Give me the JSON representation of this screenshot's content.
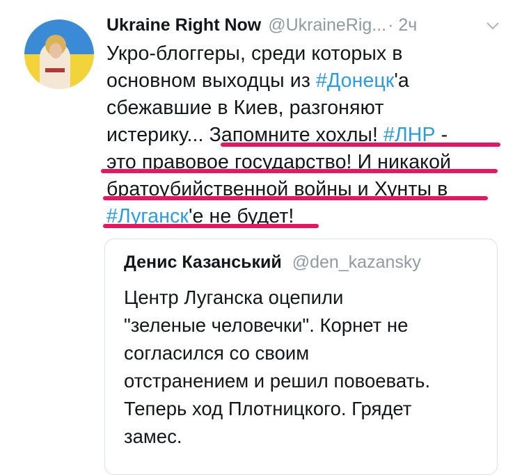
{
  "tweet": {
    "display_name": "Ukraine Right Now",
    "handle": "@UkraineRig...",
    "time": "· 2ч",
    "lines": [
      [
        {
          "t": "Укро-блоггеры, среди которых в"
        }
      ],
      [
        {
          "t": "основном выходцы из "
        },
        {
          "t": "#Донецк",
          "tag": true
        },
        {
          "t": "'а"
        }
      ],
      [
        {
          "t": "сбежавшие в Киев, разгоняют"
        }
      ],
      [
        {
          "t": "истерику... Запомните хохлы! "
        },
        {
          "t": "#ЛНР",
          "tag": true
        },
        {
          "t": " -"
        }
      ],
      [
        {
          "t": "это правовое государство! И никакой"
        }
      ],
      [
        {
          "t": "братоубийственной войны и Хунты в"
        }
      ],
      [
        {
          "t": "#Луганск",
          "tag": true
        },
        {
          "t": "'е не будет!"
        }
      ]
    ]
  },
  "quoted": {
    "display_name": "Денис Казанський",
    "handle": "@den_kazansky",
    "lines": [
      "Центр Луганска оцепили",
      "\"зеленые человечки\". Корнет не",
      "согласился со своим",
      "отстранением и решил повоевать.",
      "Теперь ход Плотницкого. Грядет",
      "замес."
    ]
  },
  "icons": {
    "menu": "chevron-down-icon",
    "avatar": "avatar-flag-image"
  },
  "colors": {
    "hashtag": "#2b9be6",
    "underline_annotation": "#e8155f",
    "secondary_text": "#8f9aa3",
    "quote_border": "#d9e0e6"
  }
}
